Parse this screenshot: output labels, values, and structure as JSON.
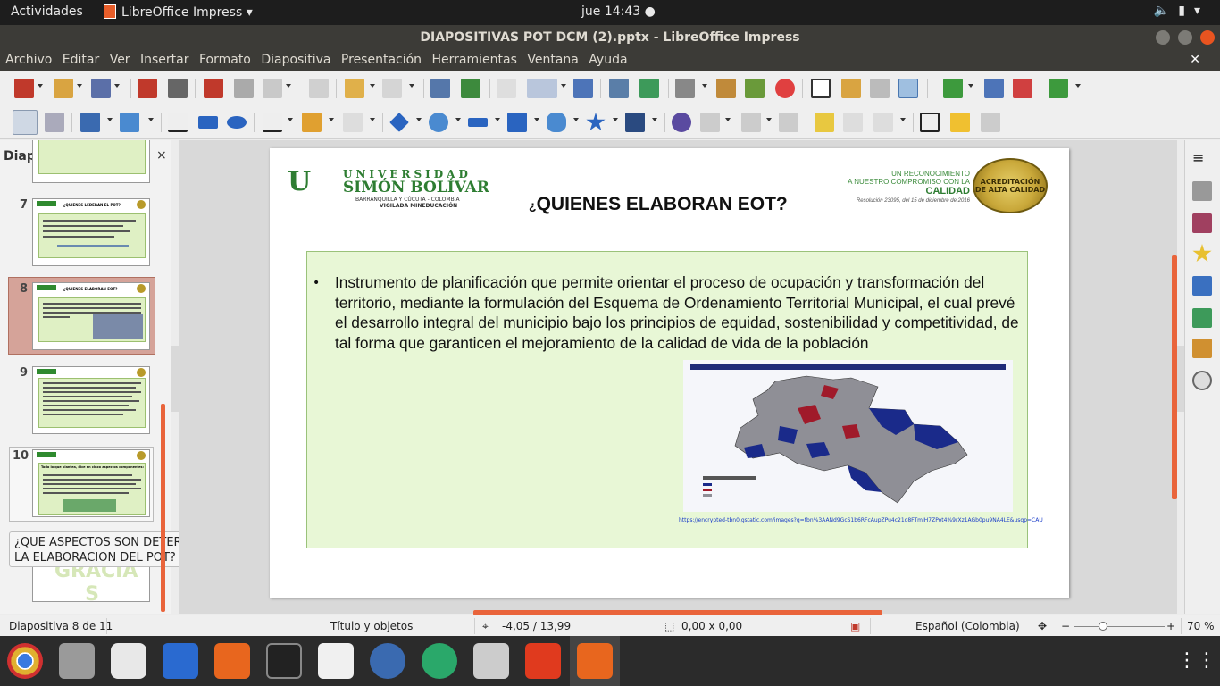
{
  "topbar": {
    "activities": "Actividades",
    "app_name": "LibreOffice Impress",
    "clock": "jue 14:43"
  },
  "window": {
    "title": "DIAPOSITIVAS POT DCM (2).pptx - LibreOffice Impress"
  },
  "menu": {
    "items": [
      "Archivo",
      "Editar",
      "Ver",
      "Insertar",
      "Formato",
      "Diapositiva",
      "Presentación",
      "Herramientas",
      "Ventana",
      "Ayuda"
    ]
  },
  "slides_pane": {
    "header": "Diapositivas",
    "close": "×",
    "thumb_numbers": [
      "7",
      "8",
      "9",
      "10"
    ],
    "thumb7_title": "¿QUIENES LEDERAN EL POT?",
    "thumb8_title": "¿QUIENES ELABORAN EOT?",
    "thumb10_title": "Todo lo que plantea, dice en cinco aspectos componentes:",
    "tooltip": "¿QUE ASPECTOS SON DETERMINANTES PARA LA ELABORACION DEL POT?",
    "last_thumb_text": "GRACIA S"
  },
  "slide": {
    "title_mark": "¿",
    "title": "QUIENES  ELABORAN EOT?",
    "logo": {
      "line1": "UNIVERSIDAD",
      "line2": "SIMÓN BOLÍVAR",
      "line3": "BARRANQUILLA Y CÚCUTA - COLOMBIA",
      "line4": "VIGILADA MINEDUCACIÓN"
    },
    "accreditation": {
      "line1": "UN RECONOCIMIENTO",
      "line2": "A NUESTRO COMPROMISO CON LA",
      "line3": "CALIDAD",
      "line4": "Resolución 23095, del 15 de diciembre de 2016"
    },
    "seal_text": "ACREDITACIÓN DE ALTA CALIDAD",
    "bullet": "Instrumento de planificación que  permite orientar el proceso de ocupación y transformación del territorio, mediante la formulación del Esquema de Ordenamiento Territorial Municipal, el cual prevé el desarrollo integral del municipio bajo los principios de equidad, sostenibilidad y competitividad, de tal forma que garanticen el mejoramiento de la calidad de vida de la población",
    "map_link": "https://encrypted-tbn0.gstatic.com/images?q=tbn%3AANd9GcS1b6RFcAupZPu4c21o8FTmIH7ZPot4%9rXz1AGb0pu9NA4LE&usqp=CAU"
  },
  "statusbar": {
    "slide_info": "Diapositiva 8 de 11",
    "layout": "Título y objetos",
    "position": "-4,05 / 13,99",
    "size": "0,00 x 0,00",
    "language": "Español (Colombia)",
    "zoom": "70 %",
    "zoom_minus": "−",
    "zoom_plus": "+"
  },
  "colors": {
    "accent": "#e9643b",
    "slide_box": "#e8f7d6",
    "logo_green": "#2e7d32"
  }
}
